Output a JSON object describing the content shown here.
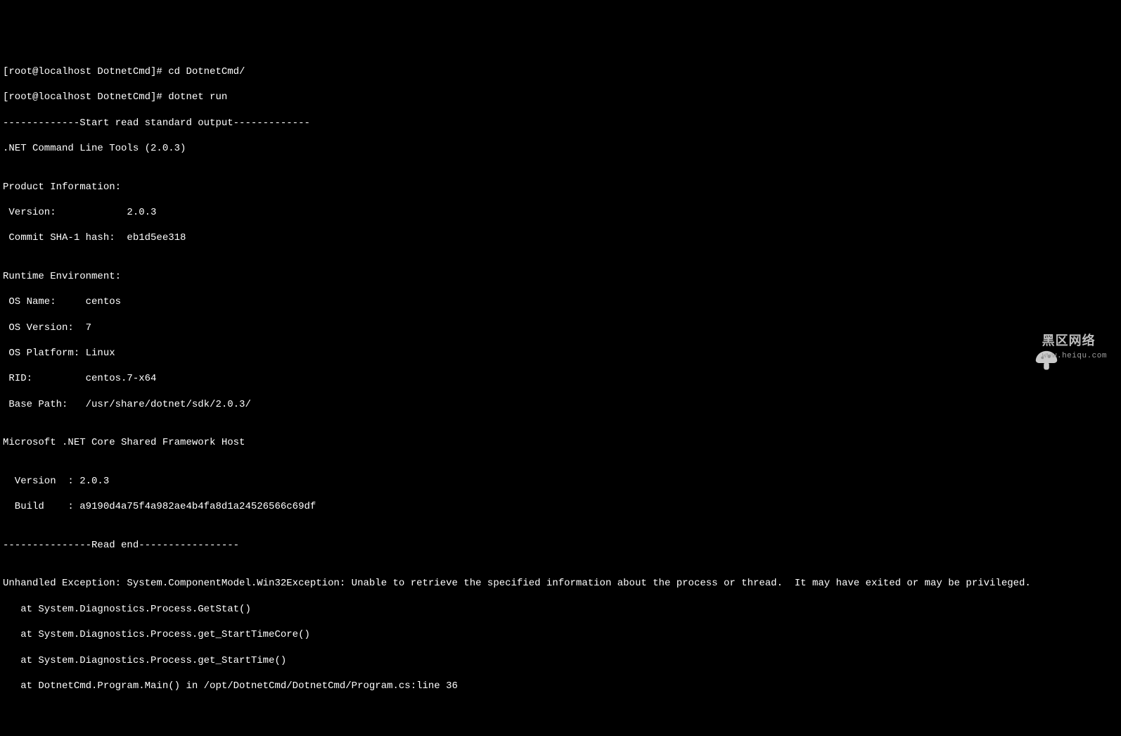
{
  "lines": [
    "[root@localhost DotnetCmd]# cd DotnetCmd/",
    "[root@localhost DotnetCmd]# dotnet run",
    "-------------Start read standard output-------------",
    ".NET Command Line Tools (2.0.3)",
    "",
    "Product Information:",
    " Version:            2.0.3",
    " Commit SHA-1 hash:  eb1d5ee318",
    "",
    "Runtime Environment:",
    " OS Name:     centos",
    " OS Version:  7",
    " OS Platform: Linux",
    " RID:         centos.7-x64",
    " Base Path:   /usr/share/dotnet/sdk/2.0.3/",
    "",
    "Microsoft .NET Core Shared Framework Host",
    "",
    "  Version  : 2.0.3",
    "  Build    : a9190d4a75f4a982ae4b4fa8d1a24526566c69df",
    "",
    "---------------Read end-----------------",
    "",
    "Unhandled Exception: System.ComponentModel.Win32Exception: Unable to retrieve the specified information about the process or thread.  It may have exited or may be privileged.",
    "   at System.Diagnostics.Process.GetStat()",
    "   at System.Diagnostics.Process.get_StartTimeCore()",
    "   at System.Diagnostics.Process.get_StartTime()",
    "   at DotnetCmd.Program.Main() in /opt/DotnetCmd/DotnetCmd/Program.cs:line 36"
  ],
  "watermark": {
    "main": "黑区网络",
    "sub": "www.heiqu.com"
  }
}
